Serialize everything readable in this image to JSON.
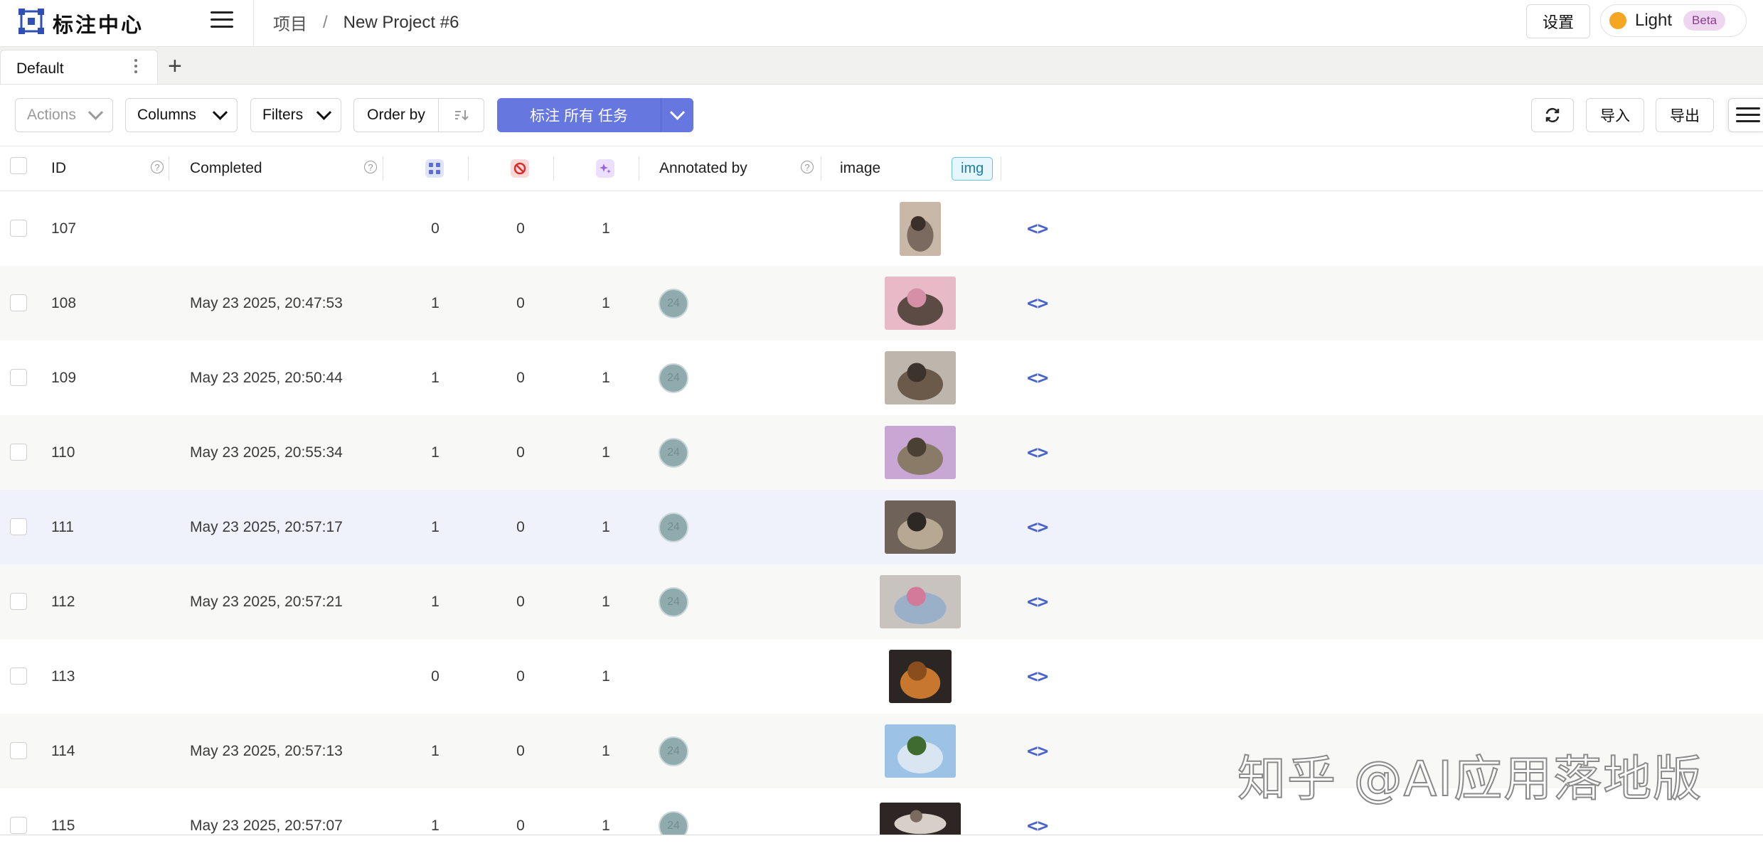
{
  "header": {
    "brand": "标注中心",
    "breadcrumb_root": "项目",
    "breadcrumb_sep": "/",
    "project_name": "New Project #6",
    "settings_label": "设置",
    "theme_label": "Light",
    "theme_badge": "Beta"
  },
  "tabs": [
    {
      "label": "Default"
    }
  ],
  "toolbar": {
    "actions_label": "Actions",
    "columns_label": "Columns",
    "filters_label": "Filters",
    "order_by_label": "Order by",
    "label_all_label": "标注 所有 任务",
    "import_label": "导入",
    "export_label": "导出",
    "accent_color": "#6777e0"
  },
  "table": {
    "columns": {
      "id": "ID",
      "completed": "Completed",
      "annotated_by": "Annotated by",
      "image": "image",
      "image_tag": "img"
    },
    "rows": [
      {
        "id": "107",
        "completed": "",
        "c1": "0",
        "c2": "0",
        "c3": "1",
        "annotator": "",
        "thumb": "thumb-107"
      },
      {
        "id": "108",
        "completed": "May 23 2025, 20:47:53",
        "c1": "1",
        "c2": "0",
        "c3": "1",
        "annotator": "24",
        "thumb": "thumb-108"
      },
      {
        "id": "109",
        "completed": "May 23 2025, 20:50:44",
        "c1": "1",
        "c2": "0",
        "c3": "1",
        "annotator": "24",
        "thumb": "thumb-109"
      },
      {
        "id": "110",
        "completed": "May 23 2025, 20:55:34",
        "c1": "1",
        "c2": "0",
        "c3": "1",
        "annotator": "24",
        "thumb": "thumb-110"
      },
      {
        "id": "111",
        "completed": "May 23 2025, 20:57:17",
        "c1": "1",
        "c2": "0",
        "c3": "1",
        "annotator": "24",
        "thumb": "thumb-111"
      },
      {
        "id": "112",
        "completed": "May 23 2025, 20:57:21",
        "c1": "1",
        "c2": "0",
        "c3": "1",
        "annotator": "24",
        "thumb": "thumb-112"
      },
      {
        "id": "113",
        "completed": "",
        "c1": "0",
        "c2": "0",
        "c3": "1",
        "annotator": "",
        "thumb": "thumb-113"
      },
      {
        "id": "114",
        "completed": "May 23 2025, 20:57:13",
        "c1": "1",
        "c2": "0",
        "c3": "1",
        "annotator": "24",
        "thumb": "thumb-114"
      },
      {
        "id": "115",
        "completed": "May 23 2025, 20:57:07",
        "c1": "1",
        "c2": "0",
        "c3": "1",
        "annotator": "24",
        "thumb": "thumb-115"
      }
    ]
  },
  "watermark": "知乎 @AI应用落地版"
}
